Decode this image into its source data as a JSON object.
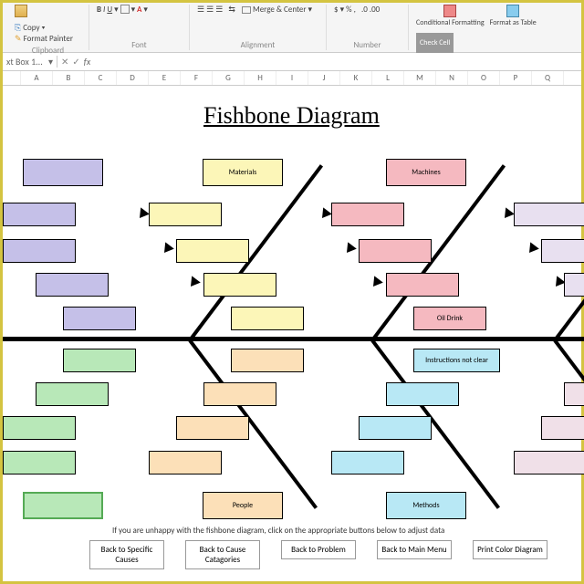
{
  "ribbon": {
    "copy": "Copy",
    "format_painter": "Format Painter",
    "clipboard": "Clipboard",
    "font": "Font",
    "alignment": "Alignment",
    "merge": "Merge & Center",
    "number": "Number",
    "conditional": "Conditional Formatting",
    "format_as": "Format as Table",
    "check": "Check Cell"
  },
  "namebox": "xt Box 1...",
  "fx": "fx",
  "cols": [
    "A",
    "B",
    "C",
    "D",
    "E",
    "F",
    "G",
    "H",
    "I",
    "J",
    "K",
    "L",
    "M",
    "N",
    "O",
    "P",
    "Q"
  ],
  "title": "Fishbone Diagram",
  "categories": {
    "materials": "Materials",
    "machines": "Machines",
    "people": "People",
    "methods": "Methods"
  },
  "causes": {
    "oil": "Oil Drink",
    "instr": "Instructions not clear"
  },
  "instruction": "If you are unhappy with the fishbone diagram, click on the appropriate buttons below to adjust data",
  "buttons": {
    "b1": "Back to Specific Causes",
    "b2": "Back to Cause Catagories",
    "b3": "Back to Problem",
    "b4": "Back to Main Menu",
    "b5": "Print Color Diagram"
  }
}
